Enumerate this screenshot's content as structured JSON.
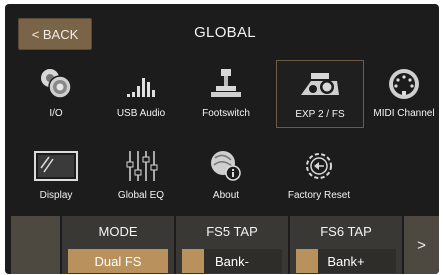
{
  "header": {
    "back_label": "< BACK",
    "title": "GLOBAL"
  },
  "tiles": [
    {
      "label": "I/O",
      "icon": "io-jack-icon"
    },
    {
      "label": "USB Audio",
      "icon": "usb-audio-bars-icon"
    },
    {
      "label": "Footswitch",
      "icon": "footswitch-icon"
    },
    {
      "label": "EXP 2 / FS",
      "icon": "expression-pedal-icon",
      "selected": true
    },
    {
      "label": "MIDI Channel",
      "icon": "midi-din-icon"
    },
    {
      "label": "Display",
      "icon": "display-icon"
    },
    {
      "label": "Global EQ",
      "icon": "eq-sliders-icon"
    },
    {
      "label": "About",
      "icon": "about-info-icon"
    },
    {
      "label": "Factory Reset",
      "icon": "factory-reset-gear-icon"
    }
  ],
  "params": [
    {
      "label": "MODE",
      "value": "Dual FS",
      "level": 1.0
    },
    {
      "label": "FS5 TAP",
      "value": "Bank-",
      "level": 0.22
    },
    {
      "label": "FS6 TAP",
      "value": "Bank+",
      "level": 0.22
    }
  ],
  "nav": {
    "next_label": ">"
  },
  "colors": {
    "accent": "#b8915c",
    "back_button": "#7a6448",
    "background": "#1c1c1c"
  }
}
